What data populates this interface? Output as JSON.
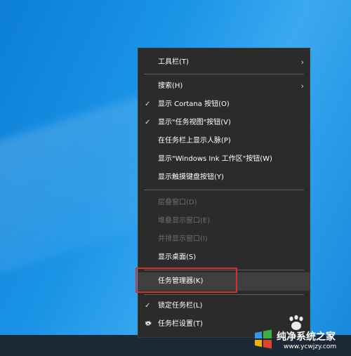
{
  "context_menu": {
    "items": [
      {
        "label": "工具栏(T)",
        "submenu": true,
        "checked": false,
        "enabled": true
      },
      {
        "label": "搜索(H)",
        "submenu": true,
        "checked": false,
        "enabled": true
      },
      {
        "label": "显示 Cortana 按钮(O)",
        "submenu": false,
        "checked": true,
        "enabled": true
      },
      {
        "label": "显示\"任务视图\"按钮(V)",
        "submenu": false,
        "checked": true,
        "enabled": true
      },
      {
        "label": "在任务栏上显示人脉(P)",
        "submenu": false,
        "checked": false,
        "enabled": true
      },
      {
        "label": "显示\"Windows Ink 工作区\"按钮(W)",
        "submenu": false,
        "checked": false,
        "enabled": true
      },
      {
        "label": "显示触摸键盘按钮(Y)",
        "submenu": false,
        "checked": false,
        "enabled": true
      },
      {
        "label": "层叠窗口(D)",
        "submenu": false,
        "checked": false,
        "enabled": false
      },
      {
        "label": "堆叠显示窗口(E)",
        "submenu": false,
        "checked": false,
        "enabled": false
      },
      {
        "label": "并排显示窗口(I)",
        "submenu": false,
        "checked": false,
        "enabled": false
      },
      {
        "label": "显示桌面(S)",
        "submenu": false,
        "checked": false,
        "enabled": true
      },
      {
        "label": "任务管理器(K)",
        "submenu": false,
        "checked": false,
        "enabled": true,
        "hovered": true
      },
      {
        "label": "锁定任务栏(L)",
        "submenu": false,
        "checked": true,
        "enabled": true
      },
      {
        "label": "任务栏设置(T)",
        "submenu": false,
        "checked": false,
        "enabled": true,
        "icon": "gear-icon"
      }
    ],
    "check_glyph": "✓",
    "chevron_glyph": "›"
  },
  "watermark": {
    "title": "纯净系统之家",
    "url": "www.ycwjzy.com"
  },
  "colors": {
    "menu_bg": "#2b2b2b",
    "highlight_border": "#d0332e",
    "desktop_blue": "#1a93e6",
    "taskbar": "#1b2a36"
  }
}
